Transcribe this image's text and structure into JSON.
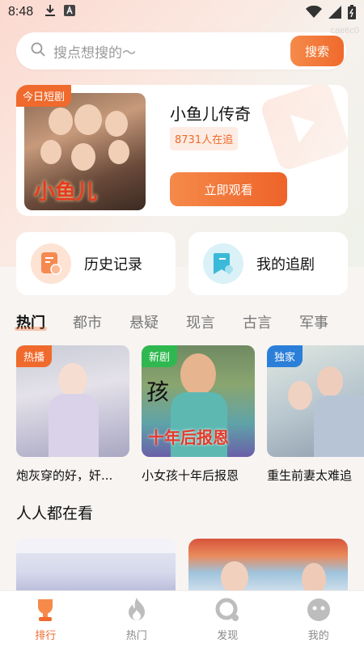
{
  "status": {
    "time": "8:48"
  },
  "watermark": "cae6c0",
  "search": {
    "placeholder": "搜点想搜的～",
    "button": "搜索"
  },
  "today": {
    "tag": "今日短剧",
    "title": "小鱼儿传奇",
    "poster_title": "小鱼儿",
    "followers": "8731人在追",
    "watch_button": "立即观看"
  },
  "quick_links": [
    {
      "label": "历史记录",
      "icon": "history-icon"
    },
    {
      "label": "我的追剧",
      "icon": "bookmark-icon"
    }
  ],
  "categories": [
    "热门",
    "都市",
    "悬疑",
    "现言",
    "古言",
    "军事"
  ],
  "cards": [
    {
      "badge": "热播",
      "badge_color": "#ef6a2c",
      "title": "炮灰穿的好，奸..."
    },
    {
      "badge": "新剧",
      "badge_color": "#2fb84f",
      "title": "小女孩十年后报恩",
      "poster_text_top": "孩",
      "poster_text_bottom": "十年后报恩"
    },
    {
      "badge": "独家",
      "badge_color": "#2b7fd9",
      "title": "重生前妻太难追"
    }
  ],
  "section_title": "人人都在看",
  "tabs": [
    {
      "label": "排行",
      "icon": "trophy-icon",
      "active": true
    },
    {
      "label": "热门",
      "icon": "flame-icon",
      "active": false
    },
    {
      "label": "发现",
      "icon": "discover-icon",
      "active": false
    },
    {
      "label": "我的",
      "icon": "profile-icon",
      "active": false
    }
  ],
  "colors": {
    "accent": "#ef6a2c"
  }
}
